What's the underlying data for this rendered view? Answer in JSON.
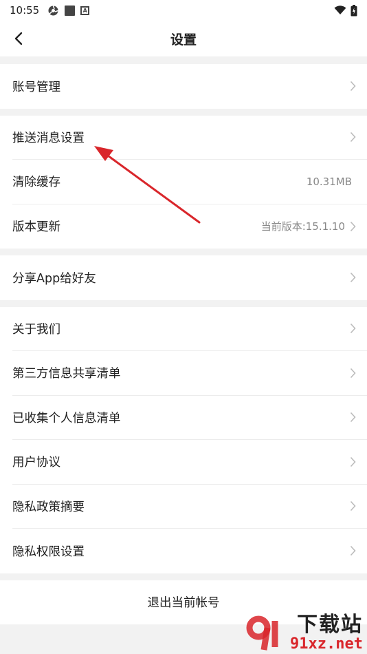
{
  "status_bar": {
    "time": "10:55"
  },
  "nav": {
    "title": "设置"
  },
  "groups": [
    {
      "items": [
        {
          "label": "账号管理"
        }
      ]
    },
    {
      "items": [
        {
          "label": "推送消息设置"
        },
        {
          "label": "清除缓存",
          "value": "10.31MB"
        },
        {
          "label": "版本更新",
          "value": "当前版本:15.1.10"
        }
      ]
    },
    {
      "items": [
        {
          "label": "分享App给好友"
        }
      ]
    },
    {
      "items": [
        {
          "label": "关于我们"
        },
        {
          "label": "第三方信息共享清单"
        },
        {
          "label": "已收集个人信息清单"
        },
        {
          "label": "用户协议"
        },
        {
          "label": "隐私政策摘要"
        },
        {
          "label": "隐私权限设置"
        }
      ]
    }
  ],
  "logout": {
    "label": "退出当前帐号"
  },
  "watermark": {
    "top": "下载站",
    "bottom": "91xz.net"
  },
  "colors": {
    "annotation_arrow": "#d9262b",
    "page_bg": "#f2f2f2"
  }
}
